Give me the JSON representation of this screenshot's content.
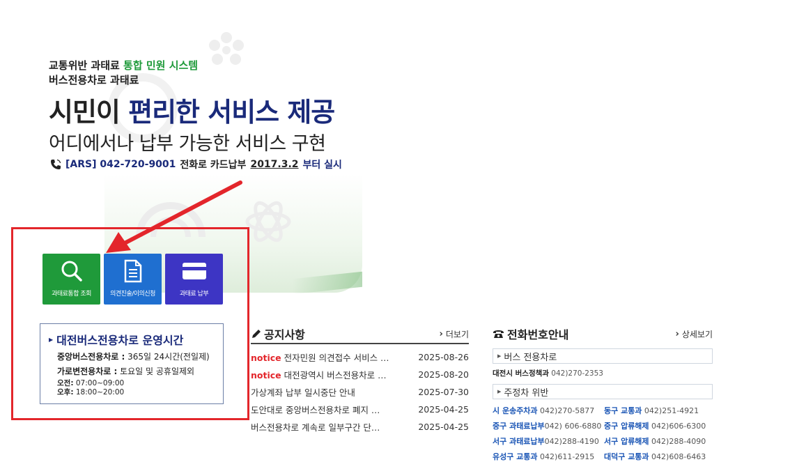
{
  "hero": {
    "line1_prefix": "교통위반 과태료 ",
    "line1_accent": "통합 민원 시스템",
    "line2": "버스전용차로 과태료",
    "title_prefix": "시민이 ",
    "title_accent": "편리한 서비스 제공",
    "subtitle": "어디에서나 납부 가능한 서비스 구현",
    "ars_label": "[ARS] 042-720-9001",
    "ars_text": " 전화로 카드납부 ",
    "ars_date": "2017.3.2",
    "ars_suffix": " 부터 실시"
  },
  "quick_buttons": [
    {
      "label": "과태료통합 조회",
      "icon": "search-icon",
      "color": "#1f9a3a"
    },
    {
      "label": "의견진술/이의신청",
      "icon": "document-icon",
      "color": "#1f6fd0"
    },
    {
      "label": "과태료 납부",
      "icon": "card-icon",
      "color": "#3d35c4"
    }
  ],
  "hours": {
    "title": "대전버스전용차로 운영시간",
    "central_label": "중앙버스전용차로 :",
    "central_value": " 365일 24시간(전일제)",
    "roadside_label": "가로변전용차로 :",
    "roadside_value": " 토요일 및 공휴일제외",
    "am_label": "오전:",
    "am_value": " 07:00~09:00",
    "pm_label": "오후:",
    "pm_value": " 18:00~20:00"
  },
  "notice": {
    "title": "공지사항",
    "more": "더보기",
    "items": [
      {
        "tag": "notice",
        "title": "전자민원 의견접수 서비스 …",
        "date": "2025-08-26"
      },
      {
        "tag": "notice",
        "title": "대전광역시 버스전용차로 …",
        "date": "2025-08-20"
      },
      {
        "tag": "",
        "title": "가상계좌 납부 일시중단 안내",
        "date": "2025-07-30"
      },
      {
        "tag": "",
        "title": "도안대로 중앙버스전용차로 폐지 …",
        "date": "2025-04-25"
      },
      {
        "tag": "",
        "title": "버스전용차로 계속로 일부구간 단…",
        "date": "2025-04-25"
      }
    ]
  },
  "phone": {
    "title": "전화번호안내",
    "more": "상세보기",
    "bus_category": "버스 전용차로",
    "bus_line_name": "대전시 버스정책과",
    "bus_line_number": " 042)270-2353",
    "parking_category": "주정차 위반",
    "contacts": [
      {
        "name": "시 운송주차과",
        "number": " 042)270-5877"
      },
      {
        "name": "동구 교통과",
        "number": " 042)251-4921"
      },
      {
        "name": "중구 과태료납부",
        "number": "042) 606-6880"
      },
      {
        "name": "중구 압류해제",
        "number": " 042)606-6300"
      },
      {
        "name": "서구 과태료납부",
        "number": "042)288-4190"
      },
      {
        "name": "서구 압류해제",
        "number": " 042)288-4090"
      },
      {
        "name": "유성구 교통과",
        "number": " 042)611-2915"
      },
      {
        "name": "대덕구 교통과",
        "number": " 042)608-6463"
      }
    ]
  },
  "colors": {
    "accent_green": "#1f9a3a",
    "accent_navy": "#1a2a7a",
    "annotation_red": "#e3262b"
  }
}
